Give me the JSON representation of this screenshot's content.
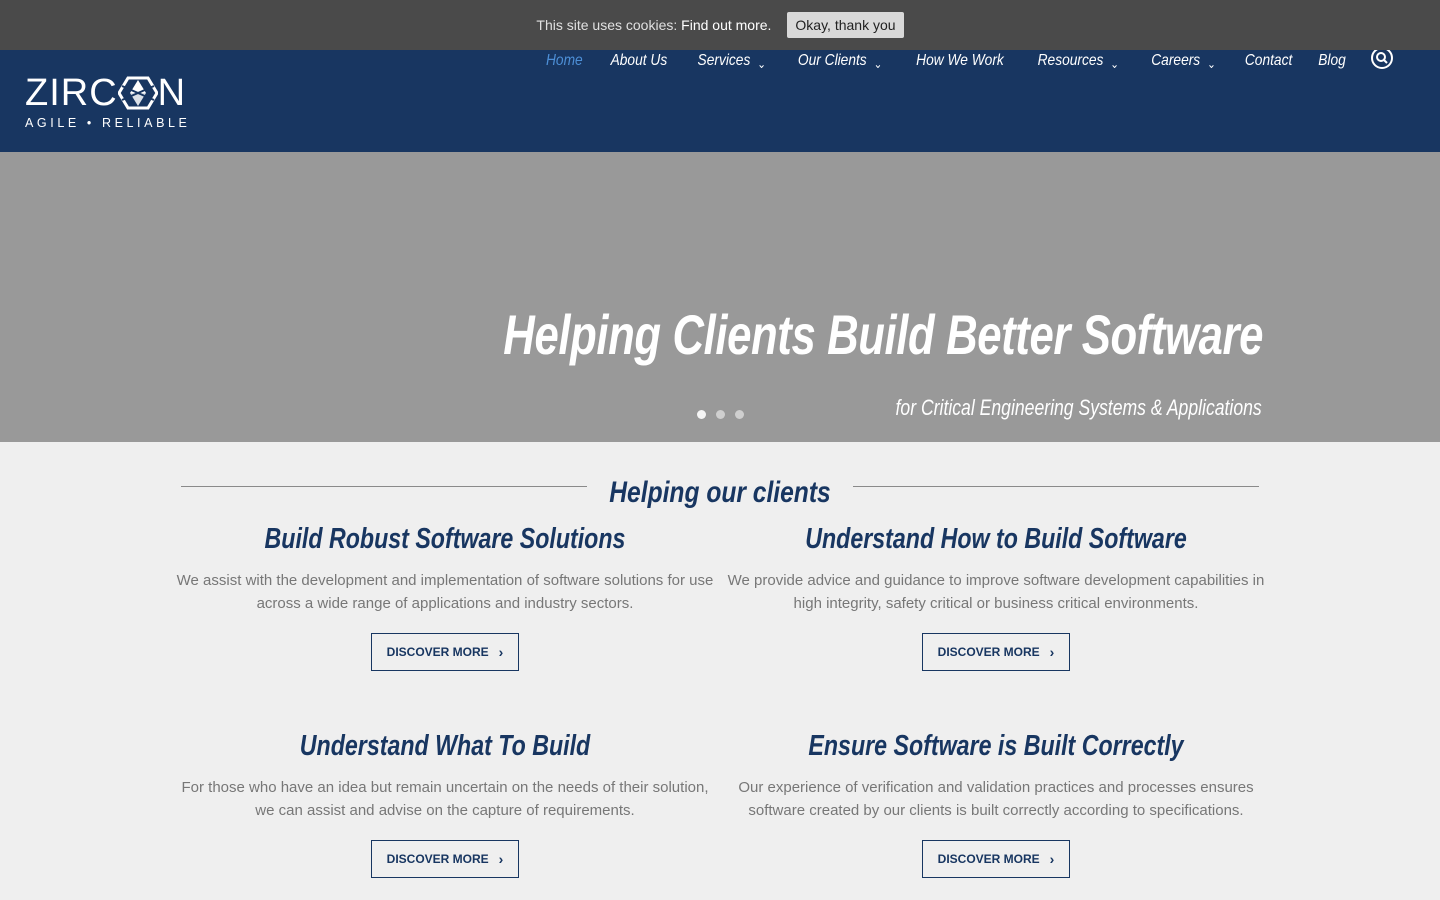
{
  "cookie": {
    "message": "This site uses cookies:",
    "link": "Find out more.",
    "button": "Okay, thank you"
  },
  "logo": {
    "word_left": "ZIRC",
    "word_right": "N",
    "tagline": "AGILE • RELIABLE"
  },
  "nav": {
    "items": [
      {
        "label": "Home",
        "active": true
      },
      {
        "label": "About Us"
      },
      {
        "label": "Services",
        "chevron": "⌄"
      },
      {
        "label": "Our Clients",
        "chevron": "⌄"
      },
      {
        "label": "How We Work"
      },
      {
        "label": "Resources",
        "chevron": "⌄"
      },
      {
        "label": "Careers",
        "chevron": "⌄"
      },
      {
        "label": "Contact"
      },
      {
        "label": "Blog"
      }
    ]
  },
  "hero": {
    "title": "Helping Clients Build Better Software",
    "subtitle": "for Critical Engineering Systems & Applications"
  },
  "section": {
    "title": "Helping our clients"
  },
  "cards": [
    {
      "title": "Build Robust Software Solutions",
      "text": "We assist with the development and implementation of software solutions for use across a wide range of applications and industry sectors.",
      "button": "DISCOVER MORE",
      "arrow": "›"
    },
    {
      "title": "Understand How to Build Software",
      "text": "We provide advice and guidance to improve software development capabilities in high integrity, safety critical or business critical environments.",
      "button": "DISCOVER MORE",
      "arrow": "›"
    },
    {
      "title": "Understand What To Build",
      "text": "For those who have an idea but remain uncertain on the needs of their solution, we can assist and advise on the capture of requirements.",
      "button": "DISCOVER MORE",
      "arrow": "›"
    },
    {
      "title": "Ensure Software is Built Correctly",
      "text": "Our experience of verification and validation practices and processes ensures software created by our clients is built correctly according to specifications.",
      "button": "DISCOVER MORE",
      "arrow": "›"
    }
  ]
}
